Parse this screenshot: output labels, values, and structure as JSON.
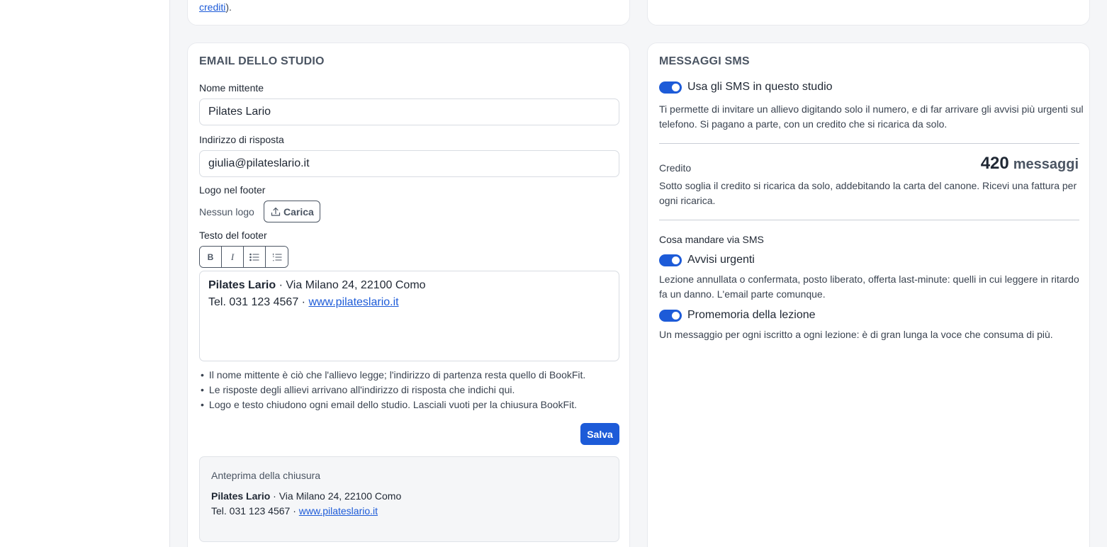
{
  "previous": {
    "left_link": "crediti",
    "left_suffix": ")."
  },
  "email": {
    "title": "EMAIL DELLO STUDIO",
    "sender_label": "Nome mittente",
    "sender_value": "Pilates Lario",
    "reply_label": "Indirizzo di risposta",
    "reply_value": "giulia@pilateslario.it",
    "logo_label": "Logo nel footer",
    "logo_status": "Nessun logo",
    "upload_label": "Carica",
    "footer_label": "Testo del footer",
    "toolbar": {
      "bold": "B",
      "italic": "I"
    },
    "footer": {
      "name": "Pilates Lario",
      "address": " · Via Milano 24, 22100 Como",
      "phone": "Tel. 031 123 4567 · ",
      "website": "www.pilateslario.it"
    },
    "notes": [
      "Il nome mittente è ciò che l'allievo legge; l'indirizzo di partenza resta quello di BookFit.",
      "Le risposte degli allievi arrivano all'indirizzo di risposta che indichi qui.",
      "Logo e testo chiudono ogni email dello studio. Lasciali vuoti per la chiusura BookFit."
    ],
    "save_label": "Salva",
    "preview_label": "Anteprima della chiusura"
  },
  "sms": {
    "title": "MESSAGGI SMS",
    "use_toggle": {
      "label": "Usa gli SMS in questo studio",
      "on": true
    },
    "use_desc": "Ti permette di invitare un allievo digitando solo il numero, e di far arrivare gli avvisi più urgenti sul telefono. Si pagano a parte, con un credito che si ricarica da solo.",
    "credit_label": "Credito",
    "credit_value": "420",
    "credit_unit": "messaggi",
    "credit_desc": "Sotto soglia il credito si ricarica da solo, addebitando la carta del canone. Ricevi una fattura per ogni ricarica.",
    "send_label": "Cosa mandare via SMS",
    "urgent_toggle": {
      "label": "Avvisi urgenti",
      "on": true
    },
    "urgent_desc": "Lezione annullata o confermata, posto liberato, offerta last-minute: quelli in cui leggere in ritardo fa un danno. L'email parte comunque.",
    "reminder_toggle": {
      "label": "Promemoria della lezione",
      "on": true
    },
    "reminder_desc": "Un messaggio per ogni iscritto a ogni lezione: è di gran lunga la voce che consuma di più."
  },
  "colors": {
    "accent": "#1d5bd8",
    "text": "#1f2733",
    "muted": "#4b5563",
    "background": "#f5f6f8"
  }
}
